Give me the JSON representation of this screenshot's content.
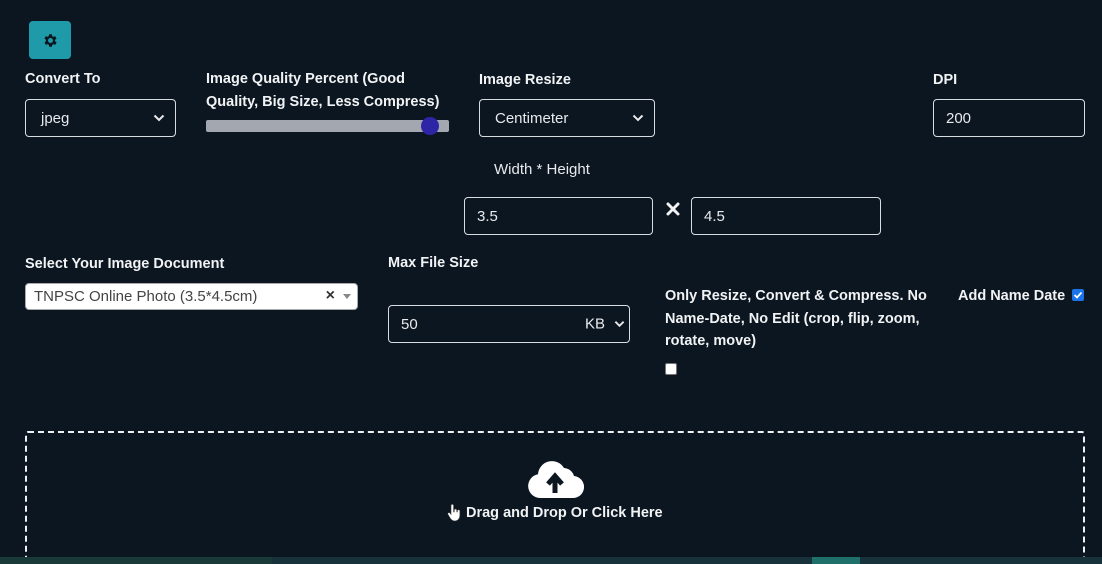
{
  "settings": {
    "icon": "gear-icon",
    "color": "#1f9aa8"
  },
  "convert_to": {
    "label": "Convert To",
    "value": "jpeg"
  },
  "quality": {
    "label_line1": "Image Quality Percent (Good",
    "label_line2": "Quality, Big Size, Less Compress)",
    "level_fraction": 0.92
  },
  "resize": {
    "label": "Image Resize",
    "value": "Centimeter"
  },
  "dpi": {
    "label": "DPI",
    "value": "200"
  },
  "dimensions": {
    "label": "Width * Height",
    "width": "3.5",
    "height": "4.5",
    "separator_icon": "times-icon"
  },
  "document": {
    "label": "Select Your Image Document",
    "value": "TNPSC Online Photo (3.5*4.5cm)",
    "clear": "×"
  },
  "max_file_size": {
    "label": "Max File Size",
    "value": "50",
    "unit": "KB"
  },
  "only_resize": {
    "text": "Only Resize, Convert & Compress. No Name-Date, No Edit (crop, flip, zoom, rotate, move)",
    "checked": false
  },
  "add_name_date": {
    "label": "Add Name Date",
    "checked": true
  },
  "dropzone": {
    "text": "Drag and Drop Or Click Here",
    "icon": "cloud-upload-icon",
    "cursor_icon": "hand-pointer-icon"
  }
}
